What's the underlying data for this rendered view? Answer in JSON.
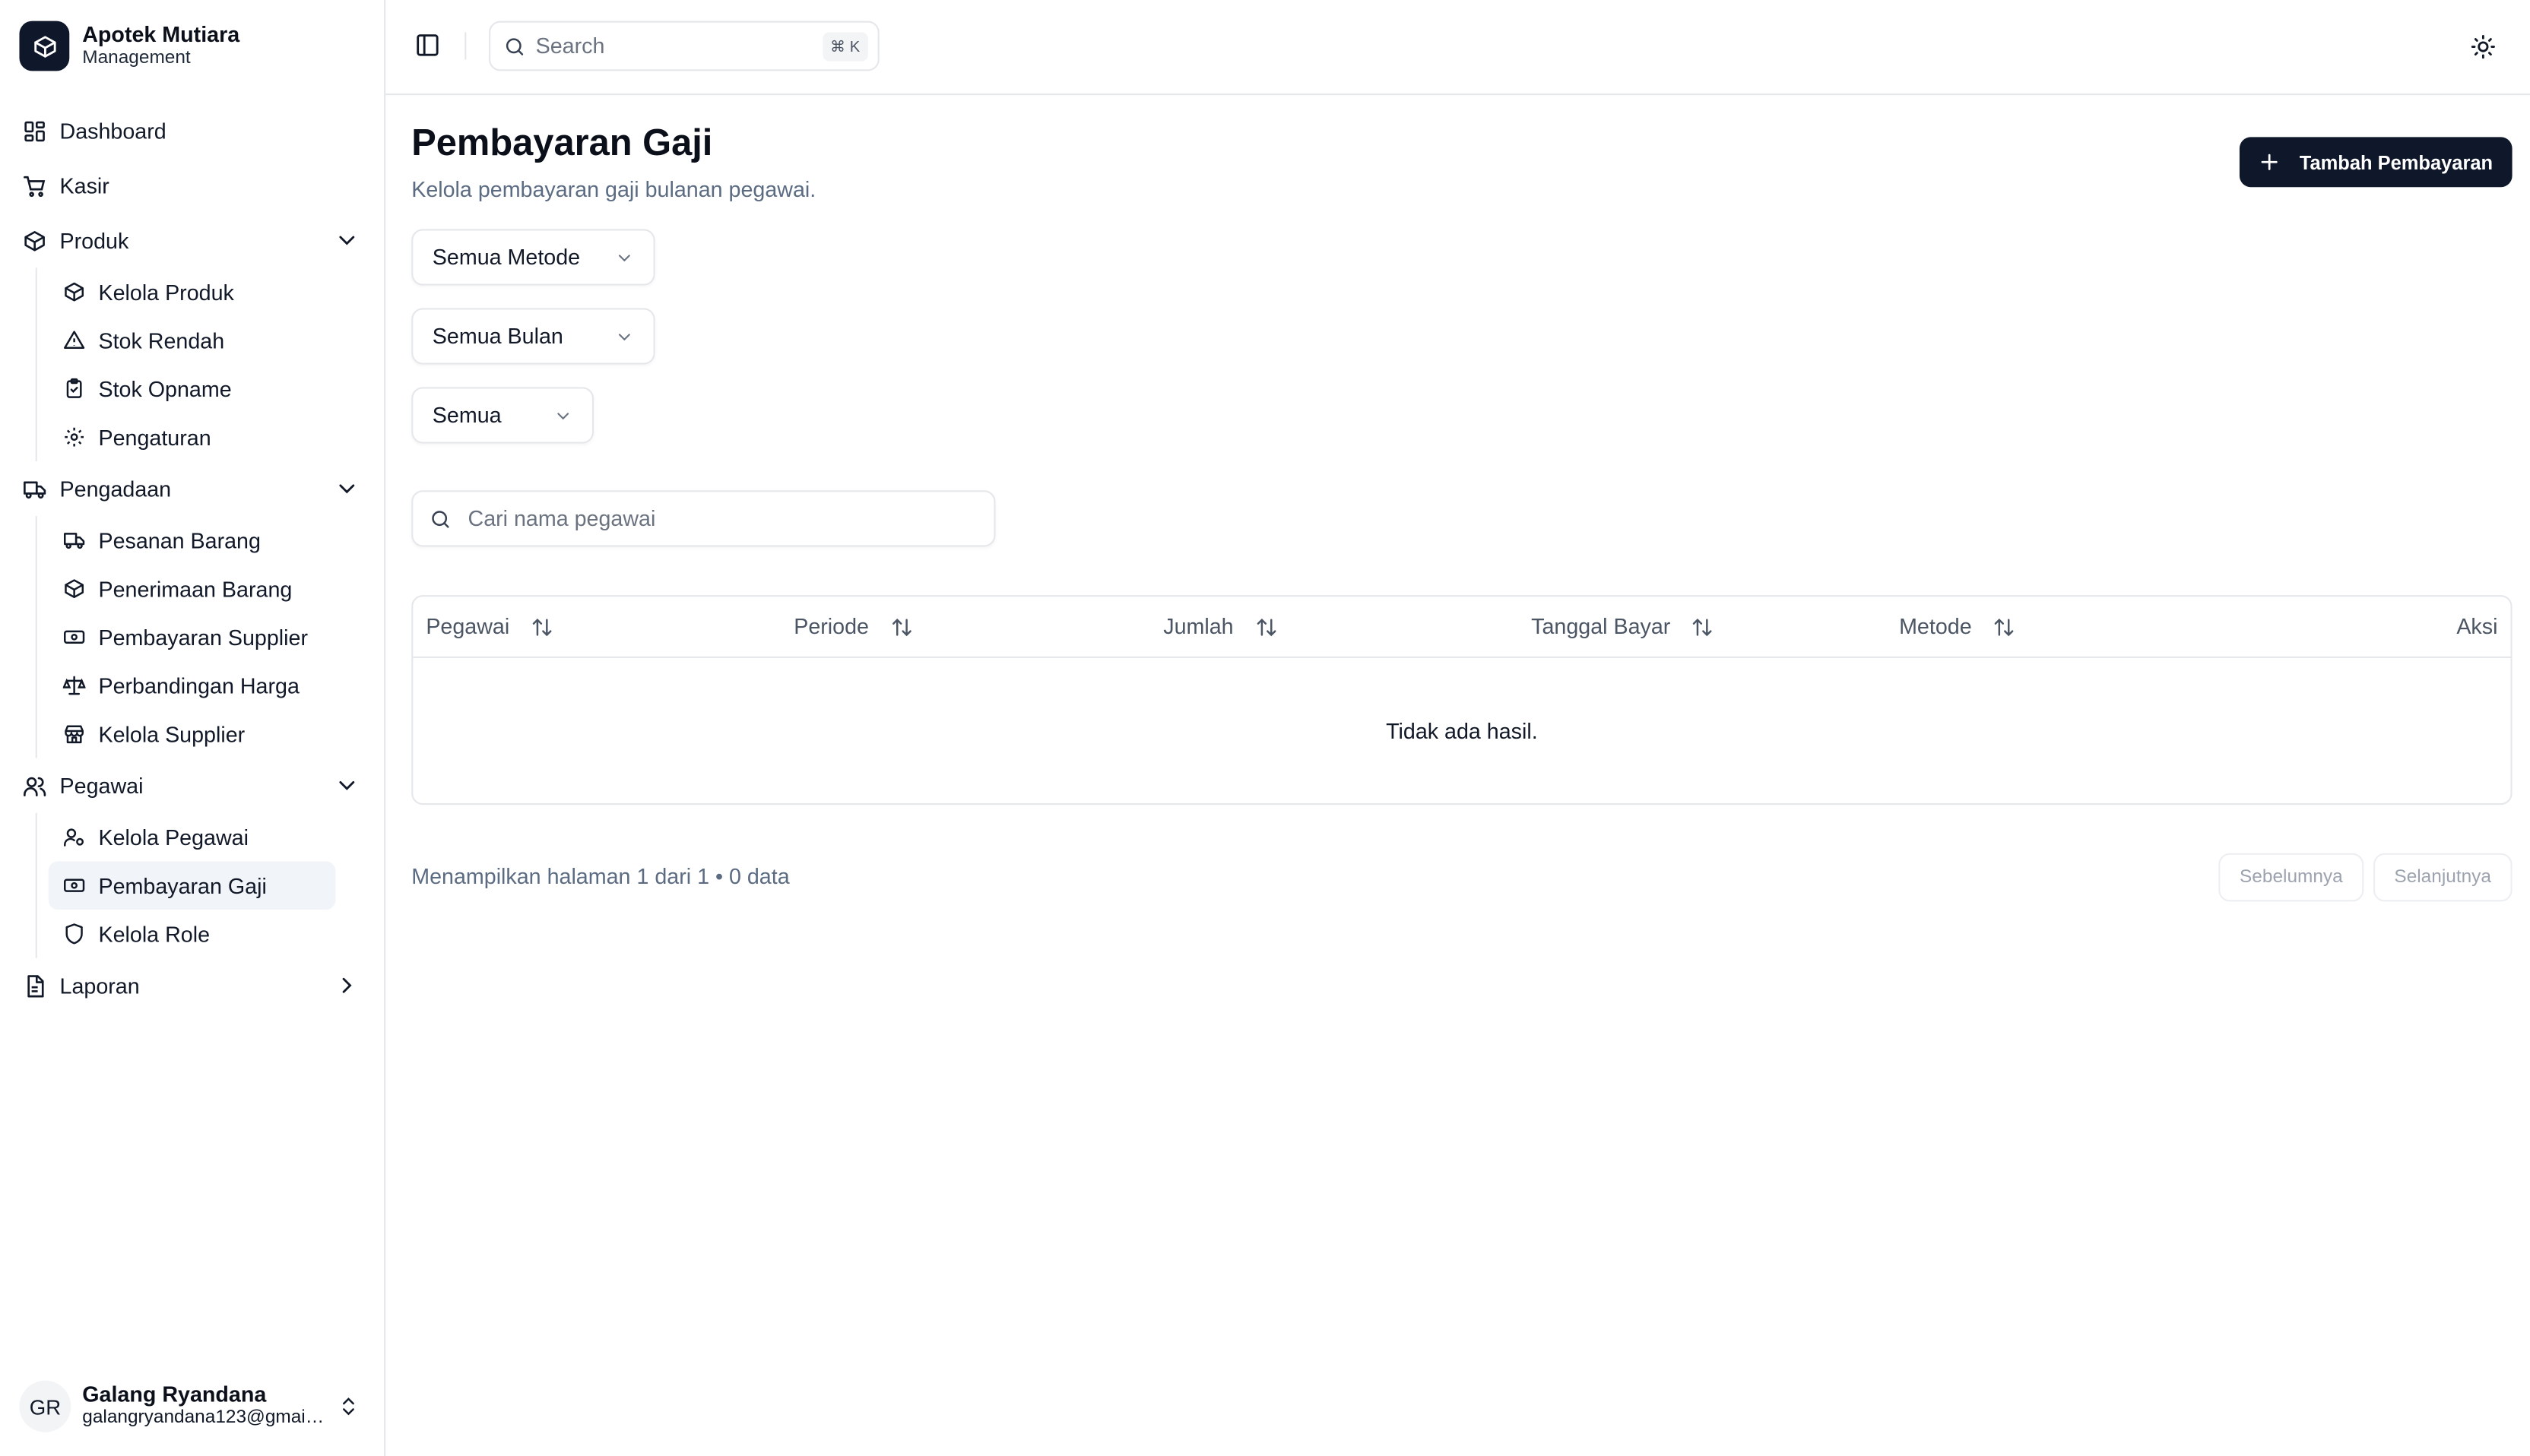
{
  "brand": {
    "title": "Apotek Mutiara",
    "subtitle": "Management"
  },
  "sidebar": {
    "dashboard": "Dashboard",
    "kasir": "Kasir",
    "produk": {
      "label": "Produk",
      "items": [
        "Kelola Produk",
        "Stok Rendah",
        "Stok Opname",
        "Pengaturan"
      ]
    },
    "pengadaan": {
      "label": "Pengadaan",
      "items": [
        "Pesanan Barang",
        "Penerimaan Barang",
        "Pembayaran Supplier",
        "Perbandingan Harga",
        "Kelola Supplier"
      ]
    },
    "pegawai": {
      "label": "Pegawai",
      "items": [
        "Kelola Pegawai",
        "Pembayaran Gaji",
        "Kelola Role"
      ],
      "active": "Pembayaran Gaji"
    },
    "laporan": "Laporan"
  },
  "user": {
    "initials": "GR",
    "name": "Galang Ryandana",
    "email": "galangryandana123@gmail.com"
  },
  "topbar": {
    "search_placeholder": "Search",
    "shortcut": "⌘ K"
  },
  "page": {
    "title": "Pembayaran Gaji",
    "subtitle": "Kelola pembayaran gaji bulanan pegawai.",
    "add_button": "Tambah Pembayaran"
  },
  "filters": {
    "method": "Semua Metode",
    "month": "Semua Bulan",
    "status": "Semua"
  },
  "employee_search": {
    "placeholder": "Cari nama pegawai"
  },
  "table": {
    "columns": [
      "Pegawai",
      "Periode",
      "Jumlah",
      "Tanggal Bayar",
      "Metode",
      "Aksi"
    ],
    "empty": "Tidak ada hasil.",
    "rows": []
  },
  "pagination": {
    "info": "Menampilkan halaman 1 dari 1 • 0 data",
    "prev": "Sebelumnya",
    "next": "Selanjutnya"
  },
  "colors": {
    "primary": "#0f172a",
    "muted_text": "#5b6b82",
    "border": "#e5e7eb",
    "active_bg": "#f1f4f8"
  }
}
